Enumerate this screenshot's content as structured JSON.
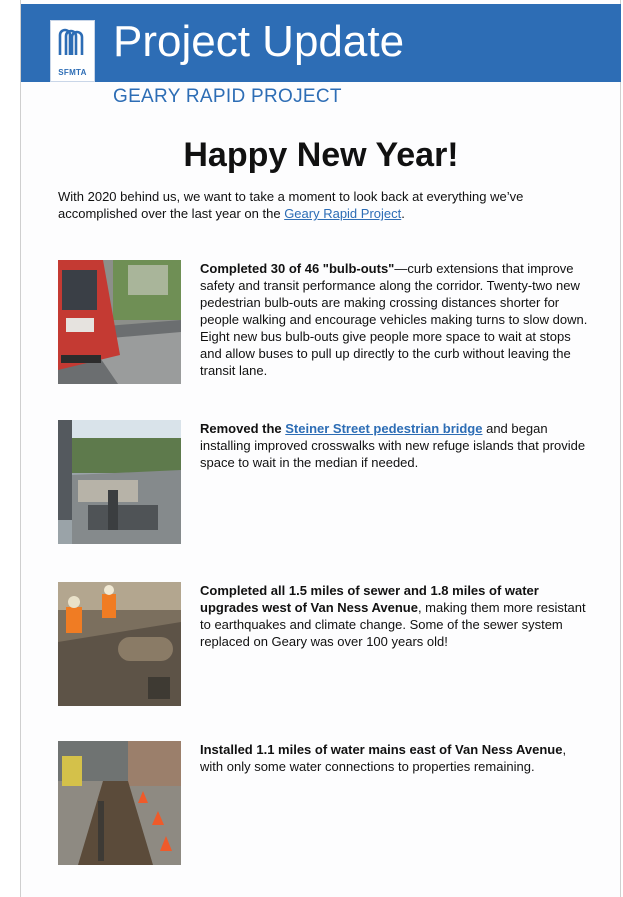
{
  "banner": {
    "title": "Project Update",
    "logo_text": "SFMTA",
    "logo_icon": "sfmta-logo-icon"
  },
  "subtitle": "GEARY RAPID PROJECT",
  "headline": "Happy New Year!",
  "intro": {
    "before": "With 2020 behind us, we want to take a moment to look back at everything we’ve accomplished over the last year on the ",
    "link": "Geary Rapid Project",
    "after": "."
  },
  "items": [
    {
      "bold": "Completed 30 of 46 \"bulb-outs\"",
      "text": "—curb extensions that improve safety and transit performance along the corridor. Twenty-two new pedestrian bulb-outs are making crossing distances shorter for people walking and encourage vehicles making turns to slow down. Eight new bus bulb-outs give people more space to wait at stops and allow buses to pull up directly to the curb without leaving the transit lane.",
      "photo": "bus-bulb-out-photo"
    },
    {
      "bold": "Removed the ",
      "link": "Steiner Street pedestrian bridge",
      "text": " and began installing improved crosswalks with new refuge islands that provide space to wait in the median if needed.",
      "photo": "bridge-removal-photo"
    },
    {
      "bold": "Completed all 1.5 miles of sewer and 1.8 miles of water upgrades west of Van Ness Avenue",
      "text": ", making them more resistant to earthquakes and climate change. Some of the sewer system replaced on Geary was over 100 years old!",
      "photo": "sewer-workers-photo"
    },
    {
      "bold": "Installed 1.1 miles of water mains east of Van Ness Avenue",
      "text": ", with only some water connections to properties remaining.",
      "photo": "water-main-trench-photo"
    }
  ],
  "colors": {
    "brand_blue": "#2d6db5"
  }
}
